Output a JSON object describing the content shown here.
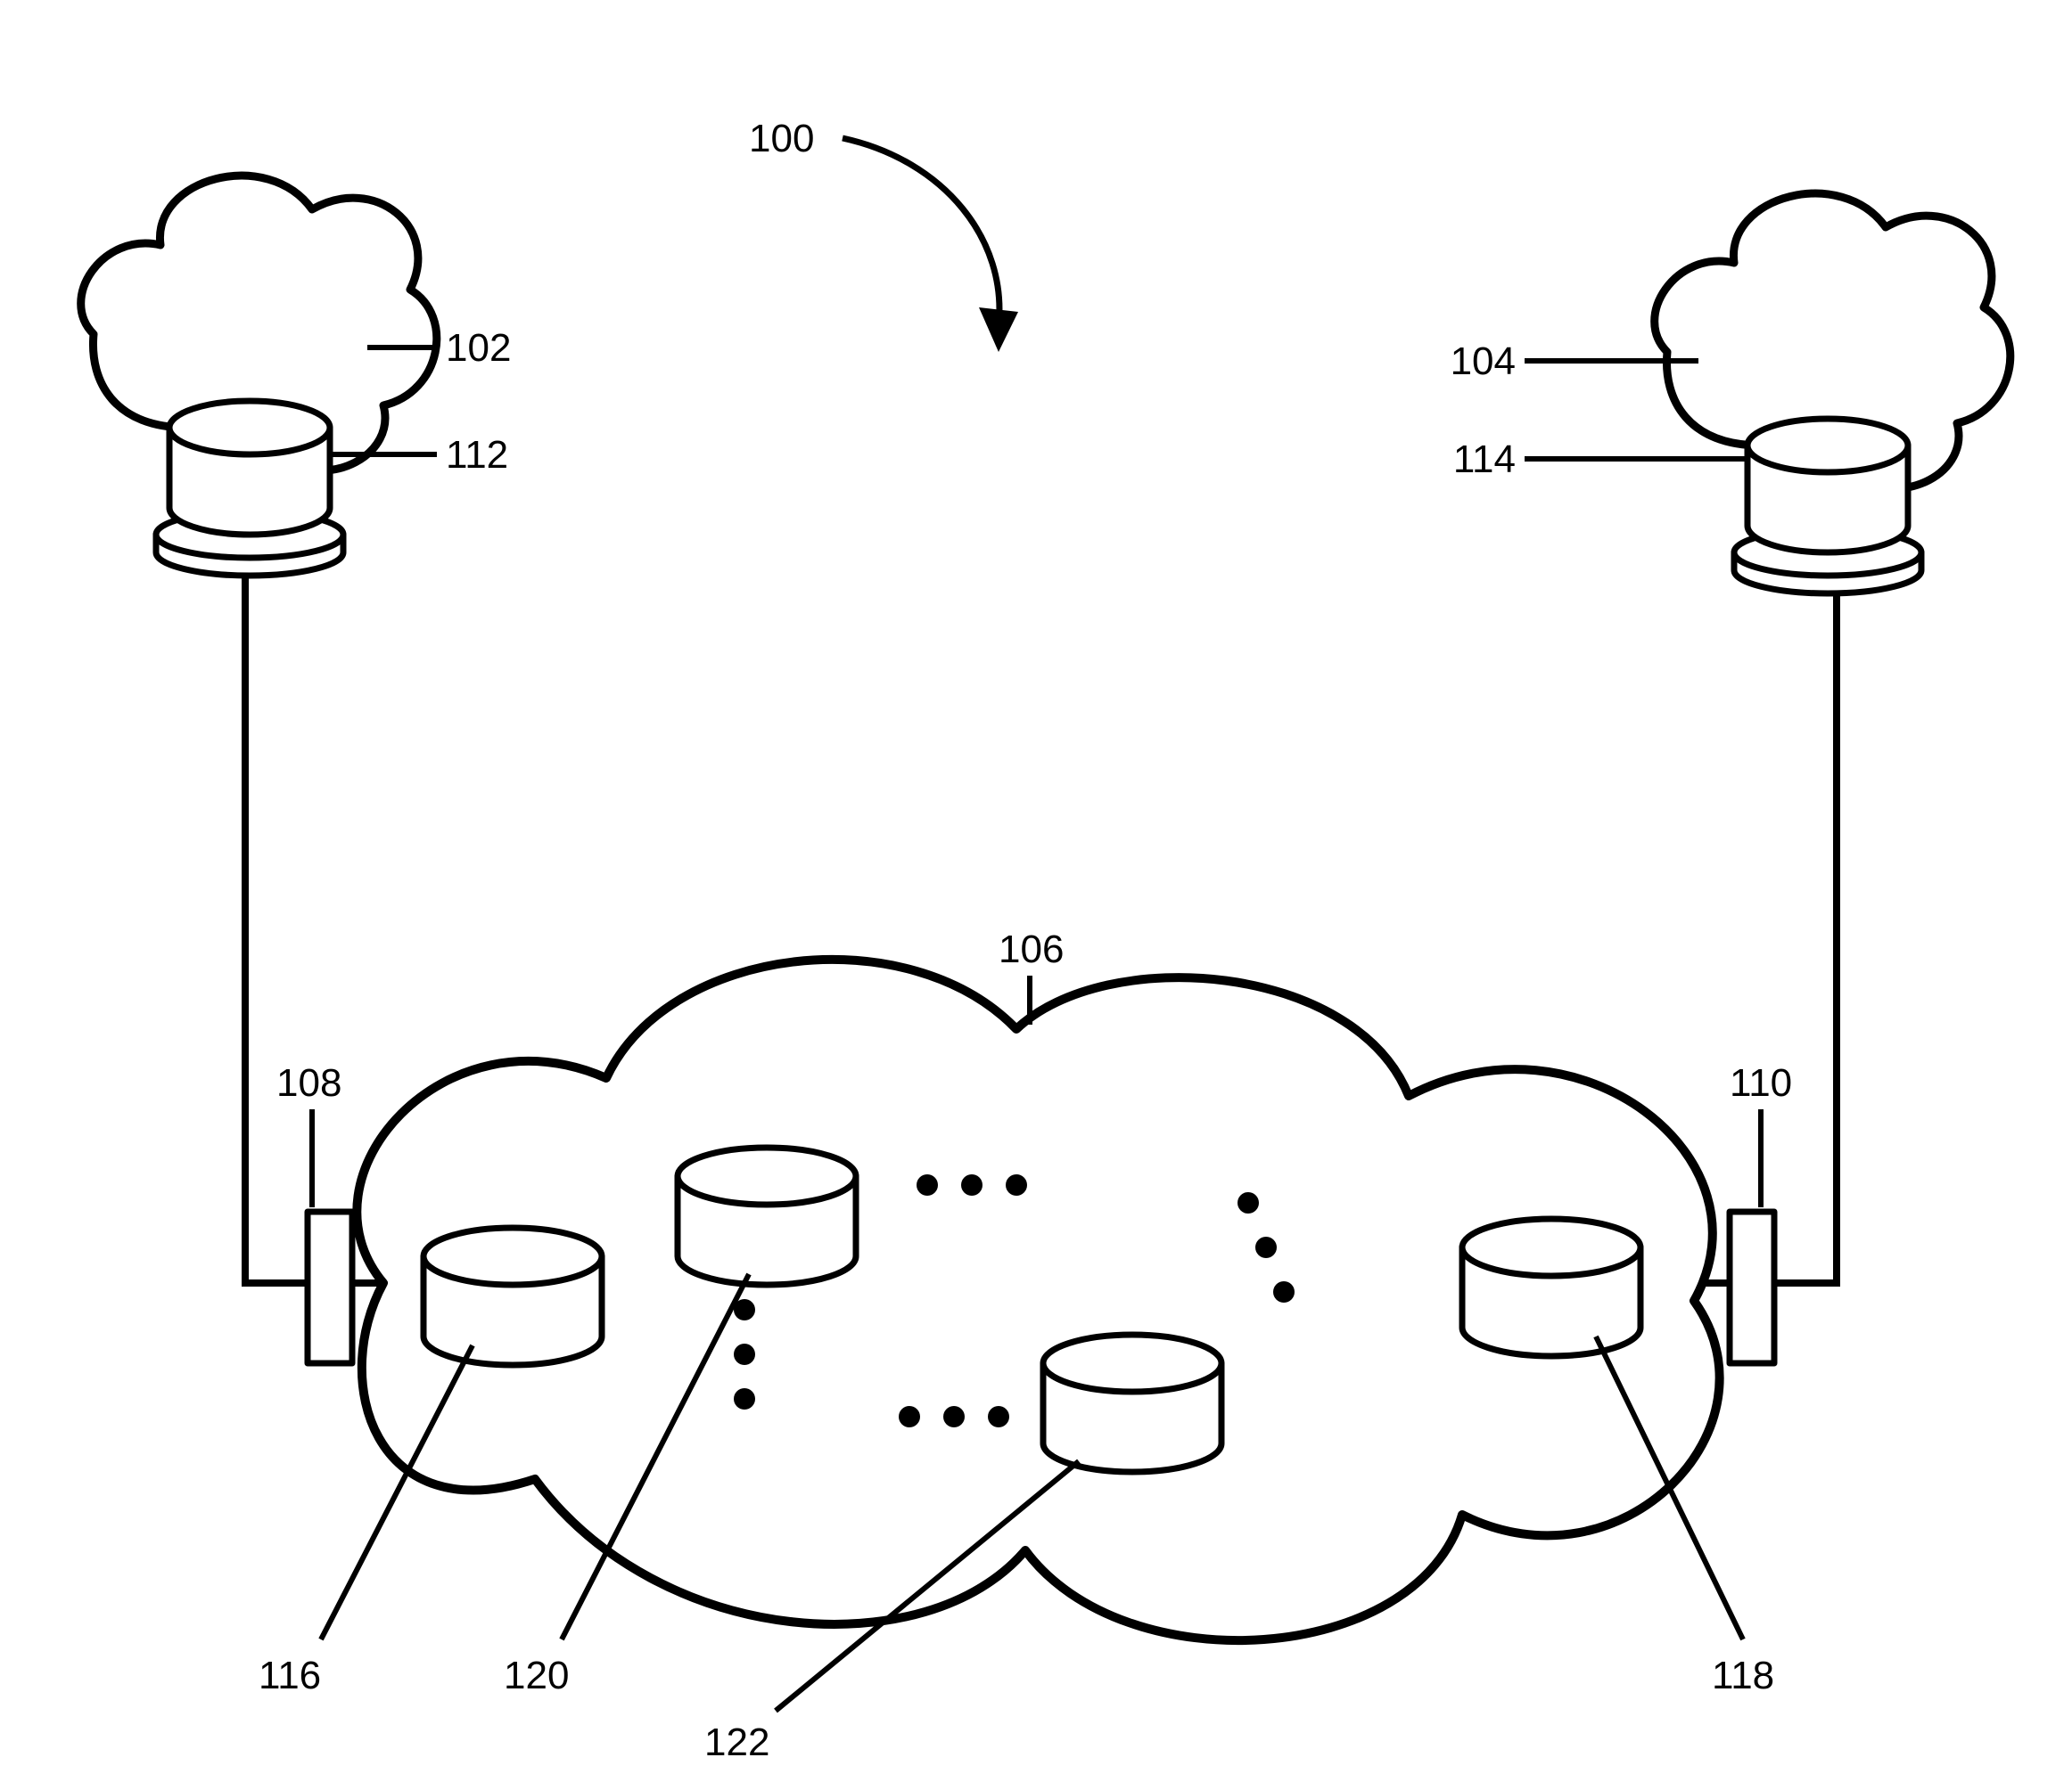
{
  "figure_ref": "100",
  "labels": {
    "left_cloud": "102",
    "right_cloud": "104",
    "left_cloud_cyl": "112",
    "right_cloud_cyl": "114",
    "big_cloud": "106",
    "left_rect": "108",
    "right_rect": "110",
    "big_left_cyl": "116",
    "big_right_cyl": "118",
    "big_mid_cyl_a": "120",
    "big_mid_cyl_b": "122"
  }
}
